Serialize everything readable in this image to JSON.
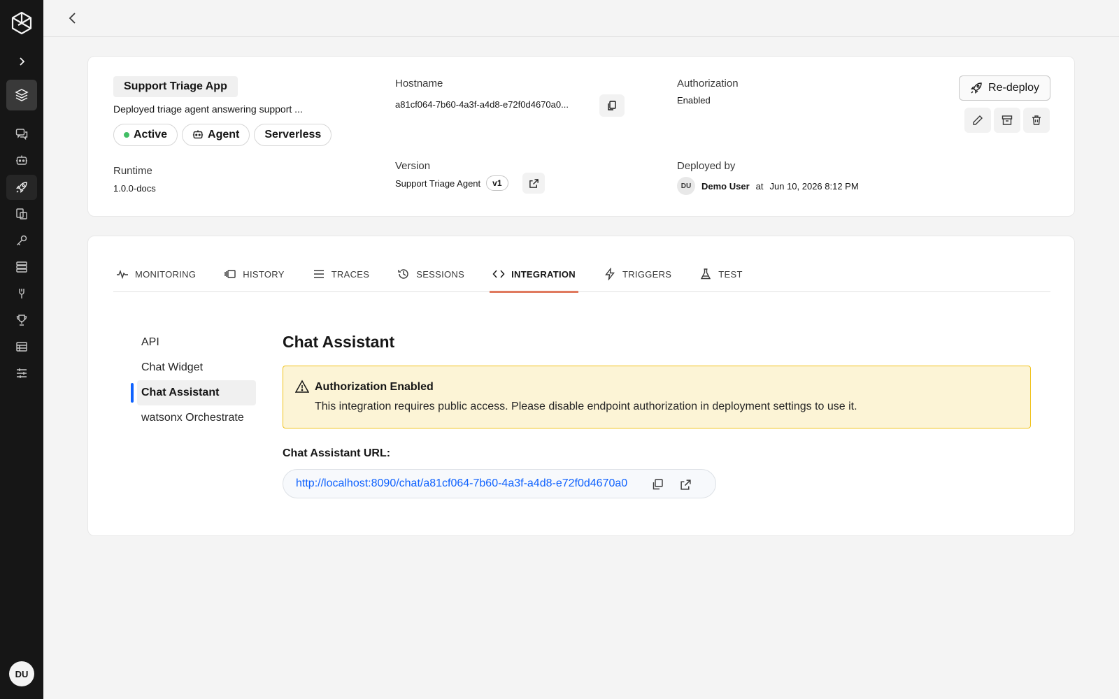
{
  "sidebar": {
    "items": [
      {
        "name": "expand",
        "icon": "chevron-right-icon"
      },
      {
        "name": "deployments-layers",
        "icon": "layers-icon"
      },
      {
        "name": "chat",
        "icon": "chat-icon"
      },
      {
        "name": "agents",
        "icon": "bot-icon"
      },
      {
        "name": "deploy",
        "icon": "rocket-icon"
      },
      {
        "name": "data",
        "icon": "database-icon"
      },
      {
        "name": "keys",
        "icon": "key-icon"
      },
      {
        "name": "catalog",
        "icon": "catalog-icon"
      },
      {
        "name": "tools",
        "icon": "tools-icon"
      },
      {
        "name": "evaluation",
        "icon": "trophy-icon"
      },
      {
        "name": "datasets",
        "icon": "table-icon"
      },
      {
        "name": "settings",
        "icon": "sliders-icon"
      }
    ],
    "avatar": "DU"
  },
  "app": {
    "name": "Support Triage App",
    "description": "Deployed triage agent answering support ...",
    "pills": [
      "Active",
      "Agent",
      "Serverless"
    ],
    "status_color": "#42be65"
  },
  "details": {
    "hostname_label": "Hostname",
    "hostname_value": "a81cf064-7b60-4a3f-a4d8-e72f0d4670a0...",
    "authorization_label": "Authorization",
    "authorization_value": "Enabled",
    "runtime_label": "Runtime",
    "runtime_value": "1.0.0-docs",
    "version_label": "Version",
    "version_value": "Support Triage Agent",
    "version_tag": "v1",
    "deployed_by_label": "Deployed by",
    "deployed_by_avatar": "DU",
    "deployed_by_user": "Demo User",
    "deployed_at_word": "at",
    "deployed_at": "Jun 10, 2026 8:12 PM"
  },
  "actions": {
    "redeploy_label": "Re-deploy"
  },
  "tabs": [
    {
      "label": "MONITORING",
      "icon": "activity-icon"
    },
    {
      "label": "HISTORY",
      "icon": "history-icon"
    },
    {
      "label": "TRACES",
      "icon": "list-icon"
    },
    {
      "label": "SESSIONS",
      "icon": "clock-icon"
    },
    {
      "label": "INTEGRATION",
      "icon": "code-icon",
      "active": true
    },
    {
      "label": "TRIGGERS",
      "icon": "bolt-icon"
    },
    {
      "label": "TEST",
      "icon": "flask-icon"
    }
  ],
  "integration": {
    "subnav": [
      "API",
      "Chat Widget",
      "Chat Assistant",
      "watsonx Orchestrate"
    ],
    "active_subnav": "Chat Assistant",
    "title": "Chat Assistant",
    "warning_title": "Authorization Enabled",
    "warning_body": "This integration requires public access. Please disable endpoint authorization in deployment settings to use it.",
    "url_label": "Chat Assistant URL:",
    "url": "http://localhost:8090/chat/a81cf064-7b60-4a3f-a4d8-e72f0d4670a0"
  },
  "colors": {
    "accent_tab": "#e07a5f",
    "warning_bg": "#fcf4d6",
    "warning_border": "#f1c21b",
    "link": "#0f62fe"
  }
}
